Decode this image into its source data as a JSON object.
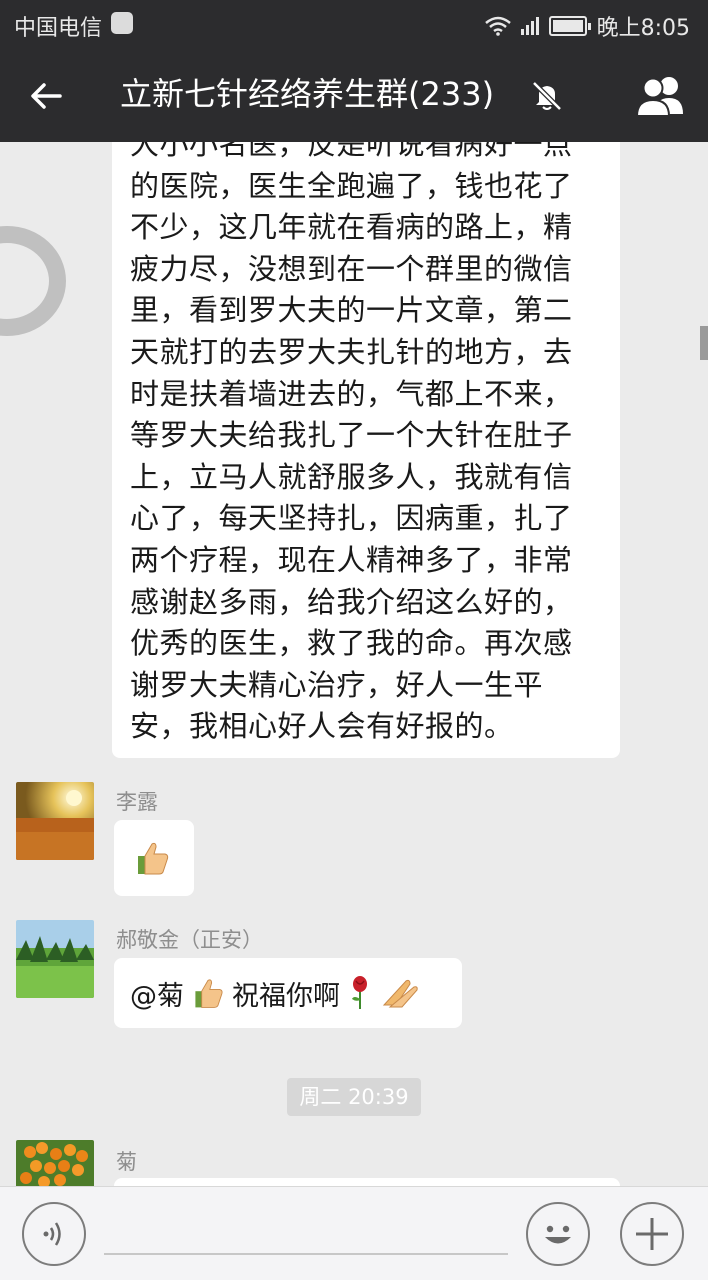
{
  "status_bar": {
    "carrier": "中国电信",
    "network": "3G/2G",
    "time": "晚上8:05",
    "icons": [
      "baidu-icon",
      "wifi-icon",
      "signal-icon",
      "battery-icon"
    ]
  },
  "header": {
    "title": "立新七针经络养生群(233)",
    "icons": [
      "back-arrow-icon",
      "mute-icon",
      "members-icon"
    ],
    "background": "#2c2c2e"
  },
  "messages": [
    {
      "type": "text",
      "lines": [
        "大小小名医，反是听说看病好一点",
        "的医院，医生全跑遍了，钱也花了",
        "不少，这几年就在看病的路上，精",
        "疲力尽，没想到在一个群里的微信",
        "里，看到罗大夫的一片文章，第二",
        "天就打的去罗大夫扎针的地方，去",
        "时是扶着墙进去的，气都上不来，",
        "等罗大夫给我扎了一个大针在肚子",
        "上，立马人就舒服多人，我就有信",
        "心了，每天坚持扎，因病重，扎了",
        "两个疗程，现在人精神多了，非常",
        "感谢赵多雨，给我介绍这么好的，",
        "优秀的医生，救了我的命。再次感",
        "谢罗大夫精心治疗，好人一生平",
        "安，我相心好人会有好报的。"
      ]
    },
    {
      "type": "emoji",
      "sender": "李露",
      "emoji": "thumbs-up"
    },
    {
      "type": "text",
      "sender": "郝敬金（正安）",
      "prefix": "@菊",
      "text": "祝福你啊",
      "emojis": [
        "thumbs-up",
        "rose",
        "pray"
      ]
    },
    {
      "type": "time",
      "text": "周二 20:39"
    },
    {
      "type": "text",
      "sender": "菊",
      "text": ""
    }
  ],
  "input_bar": {
    "icons": [
      "voice-icon",
      "emoji-icon",
      "plus-icon"
    ]
  },
  "colors": {
    "chat_bg": "#ebebeb",
    "bubble": "#ffffff",
    "bar": "#2c2c2e"
  }
}
